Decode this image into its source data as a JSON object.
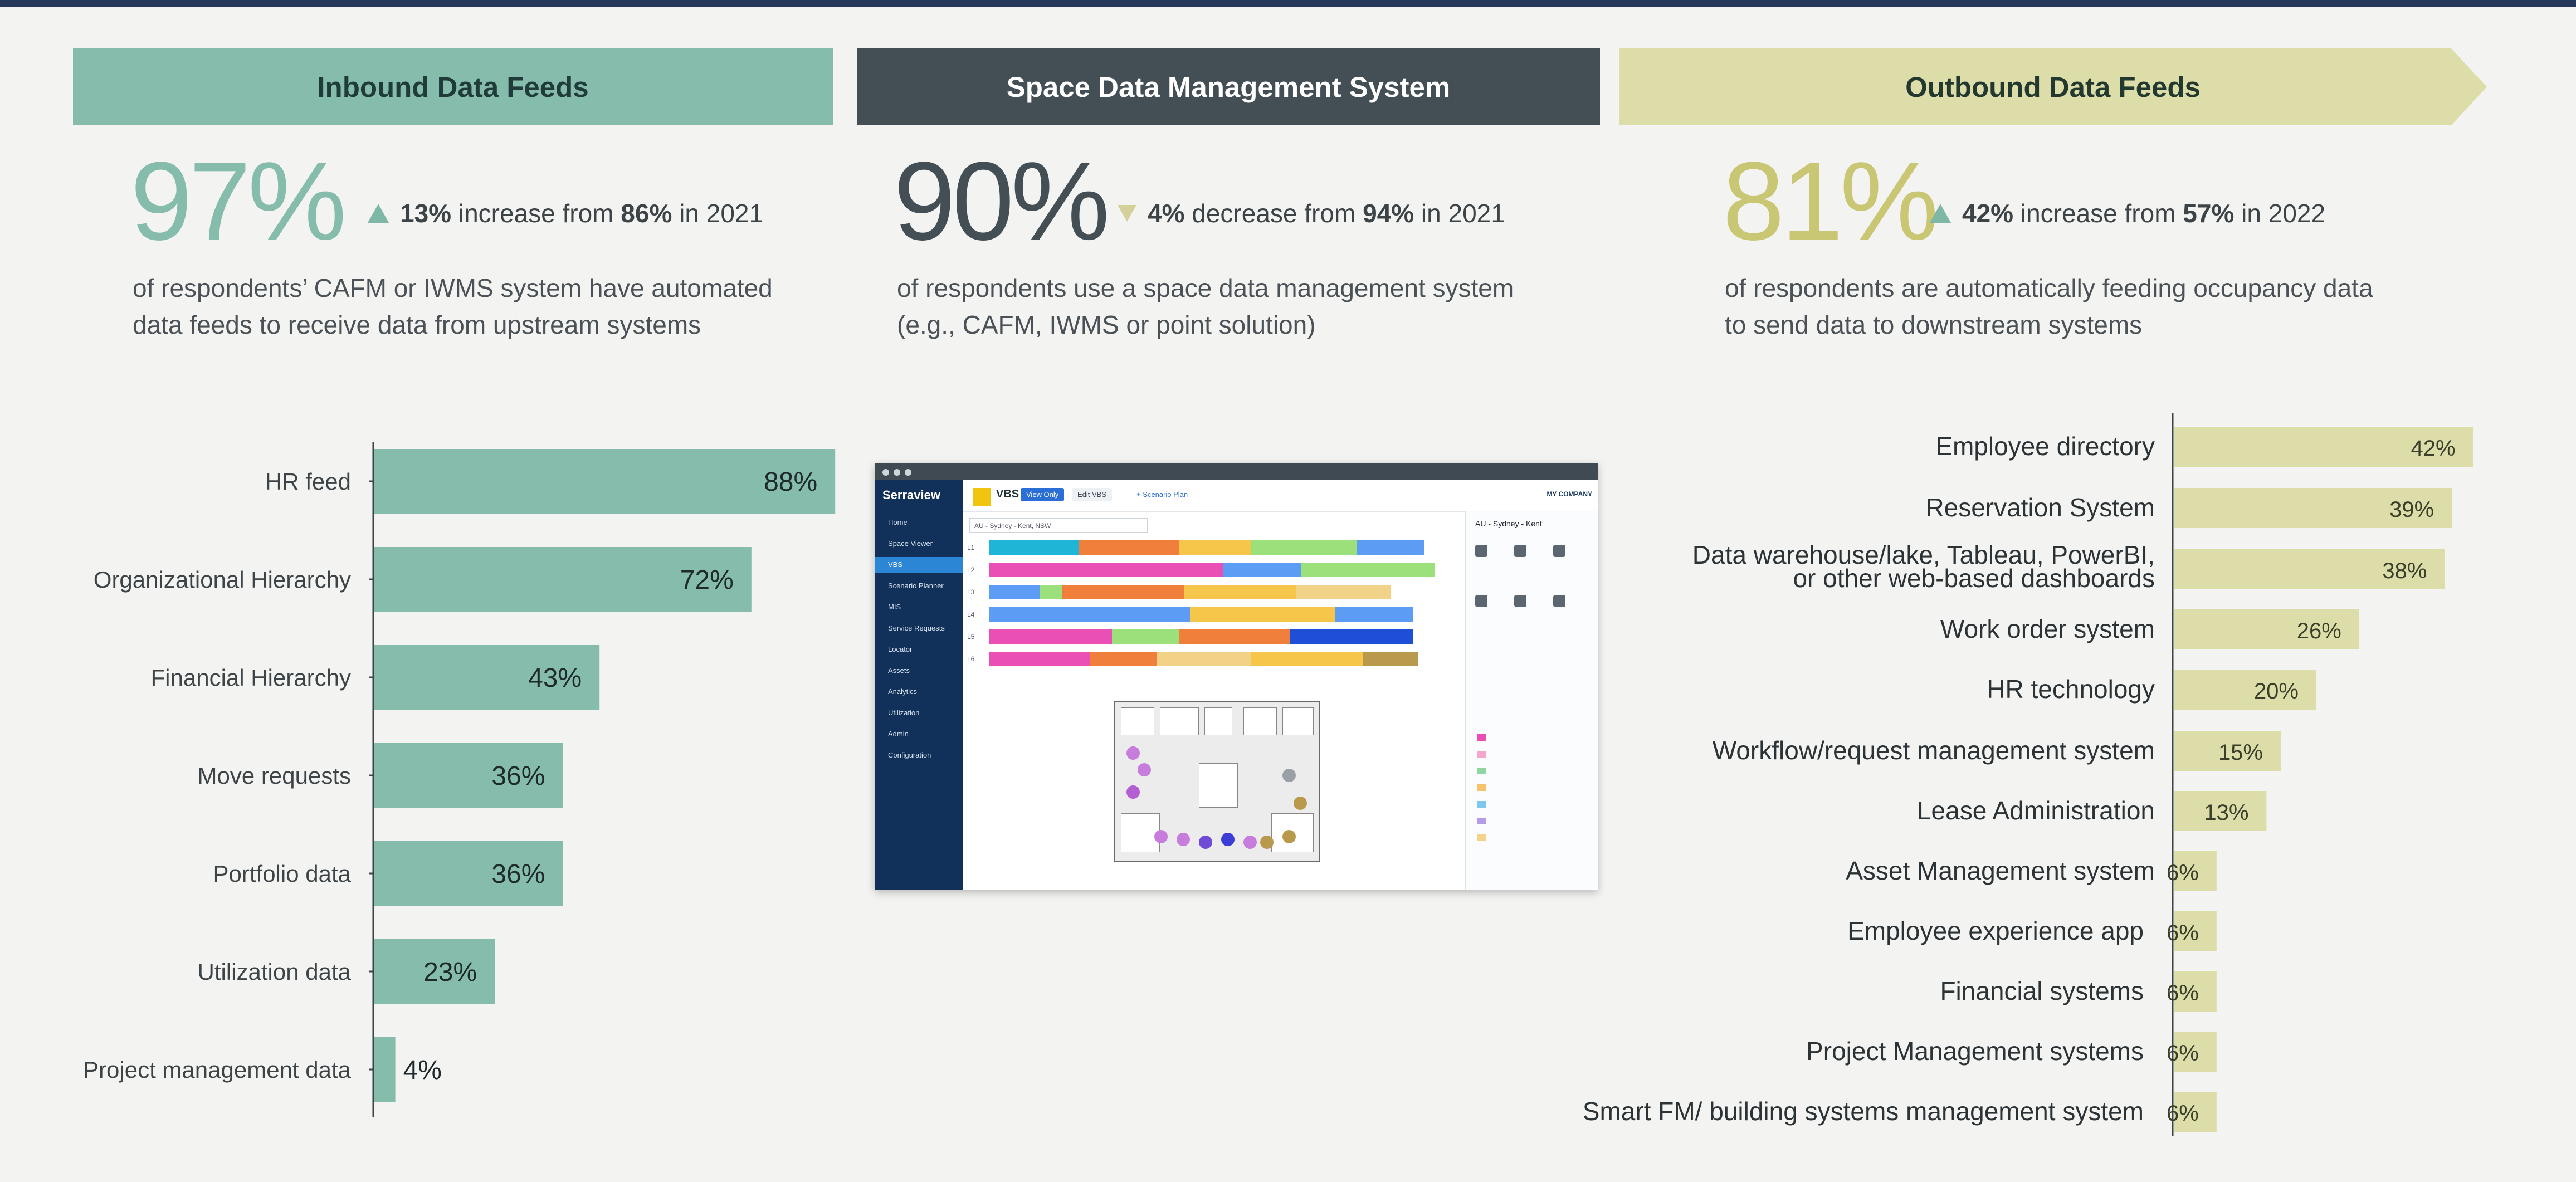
{
  "sections": [
    {
      "banner_bold": "Inbound Data",
      "banner_rest": "Feeds",
      "big_pct": "97%",
      "direction": "up",
      "change_pct": "13%",
      "change_word": "increase from",
      "from_pct": "86%",
      "from_year": "in 2021",
      "desc_line1": "of respondents’ CAFM or IWMS system have automated",
      "desc_line2": "data feeds to receive data from upstream systems",
      "accent": "#86bcab"
    },
    {
      "banner_bold": "Space Data Management System",
      "banner_rest": "",
      "big_pct": "90%",
      "direction": "down",
      "change_pct": "4%",
      "change_word": "decrease from",
      "from_pct": "94%",
      "from_year": "in 2021",
      "desc_line1": "of respondents use a space data management system",
      "desc_line2": "(e.g., CAFM, IWMS or point solution)",
      "accent": "#434f55"
    },
    {
      "banner_bold": "Outbound Data Feeds",
      "banner_rest": "",
      "big_pct": "81%",
      "direction": "up",
      "change_pct": "42%",
      "change_word": "increase from",
      "from_pct": "57%",
      "from_year": "in 2022",
      "desc_line1": "of respondents are automatically feeding occupancy data",
      "desc_line2": "to send data to downstream systems",
      "accent": "#c9c774"
    }
  ],
  "chart_data": [
    {
      "type": "bar",
      "orientation": "horizontal",
      "categories": [
        "HR feed",
        "Organizational Hierarchy",
        "Financial Hierarchy",
        "Move requests",
        "Portfolio data",
        "Utilization data",
        "Project management data"
      ],
      "values": [
        88,
        72,
        43,
        36,
        36,
        23,
        4
      ],
      "value_labels": [
        "88%",
        "72%",
        "43%",
        "36%",
        "36%",
        "23%",
        "4%"
      ],
      "color": "#86bcab",
      "xlim": [
        0,
        100
      ]
    },
    {
      "type": "bar",
      "orientation": "horizontal",
      "categories": [
        [
          "Employee directory"
        ],
        [
          "Reservation System"
        ],
        [
          "Data warehouse/lake, Tableau, PowerBI,",
          "or other web-based dashboards"
        ],
        [
          "Work order system"
        ],
        [
          "HR technology"
        ],
        [
          "Workflow/request management system"
        ],
        [
          "Lease Administration"
        ],
        [
          "Asset Management system"
        ],
        [
          "Employee experience app"
        ],
        [
          "Financial systems"
        ],
        [
          "Project Management systems"
        ],
        [
          "Smart FM/ building systems management system"
        ]
      ],
      "values": [
        42,
        39,
        38,
        26,
        20,
        15,
        13,
        6,
        6,
        6,
        6,
        6
      ],
      "value_labels": [
        "42%",
        "39%",
        "38%",
        "26%",
        "20%",
        "15%",
        "13%",
        "6%",
        "6%",
        "6%",
        "6%",
        "6%"
      ],
      "color": "#ddddaa",
      "xlim": [
        0,
        100
      ]
    }
  ],
  "screenshot": {
    "brand": "Serraview",
    "title": "VBS",
    "view_only": "View Only",
    "edit": "Edit VBS",
    "scenario": "+ Scenario Plan",
    "company": "MY COMPANY",
    "filter": "AU - Sydney - Kent, NSW",
    "panel_title": "AU - Sydney - Kent",
    "nav": [
      "Home",
      "Space Viewer",
      "VBS",
      "Scenario Planner",
      "MIS",
      "Service Requests",
      "Locator",
      "Assets",
      "Analytics",
      "Utilization",
      "Admin",
      "Configuration"
    ],
    "floors": [
      "L1",
      "L2",
      "L3",
      "L4",
      "L5",
      "L6"
    ],
    "legend_colors": [
      "#e94fb5",
      "#f6a5cd",
      "#8fd6a0",
      "#f6c26a",
      "#7ec8f0",
      "#b59ce9",
      "#f4d28a"
    ],
    "segment_colors": [
      "#1fb5d6",
      "#ef7f3a",
      "#f5c64a",
      "#9be07a",
      "#e94fb5",
      "#5c9cf5",
      "#1f4fd6",
      "#f2d287",
      "#b99a4d"
    ]
  }
}
